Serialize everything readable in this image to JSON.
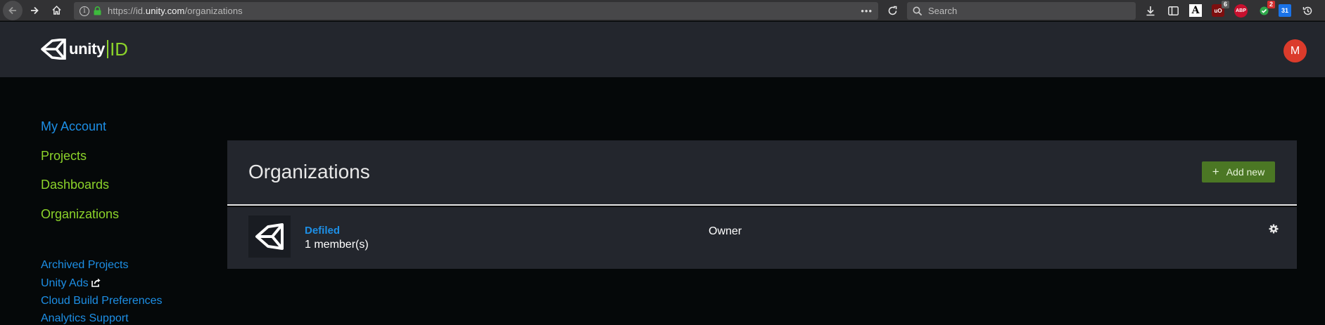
{
  "browser": {
    "url_prefix": "https://id.",
    "url_host": "unity.com",
    "url_path": "/organizations",
    "more_label": "•••",
    "search_placeholder": "Search",
    "ext_ublock_badge": "6",
    "ext_ublock_label": "uO",
    "ext_abp_label": "ABP",
    "ext_green_badge": "2",
    "ext_calendar_label": "31",
    "ext_a_label": "A"
  },
  "header": {
    "logo_text": "unity",
    "logo_id": "ID",
    "avatar_initial": "M"
  },
  "sidebar": {
    "primary": [
      {
        "label": "My Account",
        "color": "blue"
      },
      {
        "label": "Projects",
        "color": "green"
      },
      {
        "label": "Dashboards",
        "color": "green"
      },
      {
        "label": "Organizations",
        "color": "green"
      }
    ],
    "secondary": [
      {
        "label": "Archived Projects"
      },
      {
        "label": "Unity Ads"
      },
      {
        "label": "Cloud Build Preferences"
      },
      {
        "label": "Analytics Support"
      }
    ]
  },
  "main": {
    "title": "Organizations",
    "add_button_label": "Add new",
    "organizations": [
      {
        "name": "Defiled",
        "members": "1 member(s)",
        "role": "Owner"
      }
    ]
  },
  "colors": {
    "link_blue": "#1d8fe6",
    "accent_green": "#8cd32a",
    "add_button": "#4b7724",
    "avatar": "#db3b2b",
    "panel": "#23262d",
    "page_bg": "#050809"
  }
}
